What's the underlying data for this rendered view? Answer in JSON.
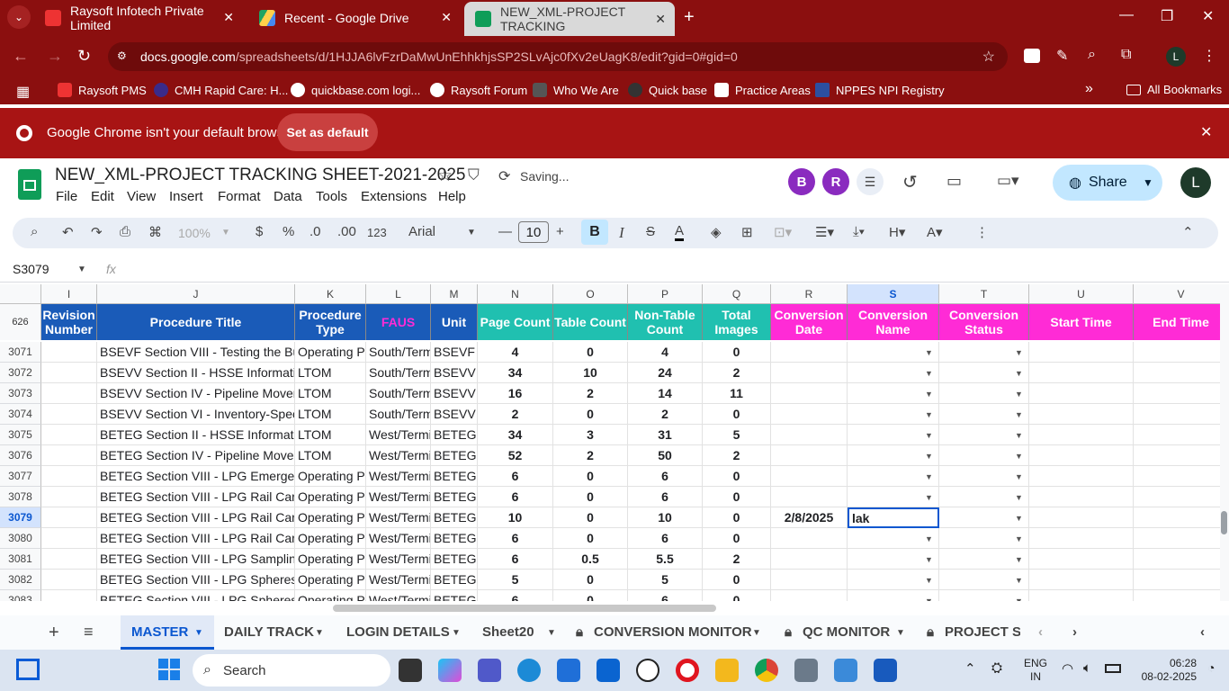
{
  "browser": {
    "tabs": [
      {
        "title": "Raysoft Infotech Private Limited",
        "active": false
      },
      {
        "title": "Recent - Google Drive",
        "active": false
      },
      {
        "title": "NEW_XML-PROJECT TRACKING",
        "active": true
      }
    ],
    "url_domain": "docs.google.com",
    "url_path": "/spreadsheets/d/1HJJA6lvFzrDaMwUnEhhkhjsSP2SLvAjc0fXv2eUagK8/edit?gid=0#gid=0",
    "bookmarks": [
      "Raysoft PMS",
      "CMH Rapid Care: H...",
      "quickbase.com logi...",
      "Raysoft Forum",
      "Who We Are",
      "Quick base",
      "Practice Areas",
      "NPPES NPI Registry"
    ],
    "all_bookmarks": "All Bookmarks",
    "profile_initial": "L",
    "infobar_text": "Google Chrome isn't your default browser",
    "set_default_label": "Set as default"
  },
  "doc": {
    "title": "NEW_XML-PROJECT TRACKING SHEET-2021-2025",
    "status": "Saving...",
    "menus": [
      "File",
      "Edit",
      "View",
      "Insert",
      "Format",
      "Data",
      "Tools",
      "Extensions",
      "Help"
    ],
    "avatars": [
      "B",
      "R"
    ],
    "share_label": "Share",
    "user_initial": "L"
  },
  "toolbar": {
    "zoom": "100%",
    "currency": "$",
    "percent": "%",
    "dec_dec": ".0",
    "inc_dec": ".00",
    "num_fmt": "123",
    "font": "Arial",
    "font_size": "10"
  },
  "formula_bar": {
    "name_box": "S3079",
    "fx": "fx"
  },
  "grid": {
    "freeze_label": "626",
    "col_letters": [
      "I",
      "J",
      "K",
      "L",
      "M",
      "N",
      "O",
      "P",
      "Q",
      "R",
      "S",
      "T",
      "U",
      "V"
    ],
    "headers": [
      "Revision Number",
      "Procedure Title",
      "Procedure Type",
      "FAUS",
      "Unit",
      "Page Count",
      "Table Count",
      "Non-Table Count",
      "Total Images",
      "Conversion Date",
      "Conversion Name",
      "Conversion Status",
      "Start Time",
      "End Time"
    ],
    "rows": [
      {
        "n": "3071",
        "title": "BSEVF Section VIII - Testing the Buta",
        "type": "Operating Pr",
        "faus": "South/Term",
        "unit": "BSEVF",
        "page": "4",
        "table": "0",
        "nontable": "4",
        "images": "0",
        "date": "",
        "name": ""
      },
      {
        "n": "3072",
        "title": "BSEVV Section II - HSSE Information",
        "type": "LTOM",
        "faus": "South/Term",
        "unit": "BSEVV",
        "page": "34",
        "table": "10",
        "nontable": "24",
        "images": "2",
        "date": "",
        "name": ""
      },
      {
        "n": "3073",
        "title": "BSEVV Section IV - Pipeline Moveme",
        "type": "LTOM",
        "faus": "South/Term",
        "unit": "BSEVV",
        "page": "16",
        "table": "2",
        "nontable": "14",
        "images": "11",
        "date": "",
        "name": ""
      },
      {
        "n": "3074",
        "title": "BSEVV Section VI - Inventory-Specific",
        "type": "LTOM",
        "faus": "South/Term",
        "unit": "BSEVV",
        "page": "2",
        "table": "0",
        "nontable": "2",
        "images": "0",
        "date": "",
        "name": ""
      },
      {
        "n": "3075",
        "title": "BETEG Section II - HSSE Information",
        "type": "LTOM",
        "faus": "West/Termi",
        "unit": "BETEG",
        "page": "34",
        "table": "3",
        "nontable": "31",
        "images": "5",
        "date": "",
        "name": ""
      },
      {
        "n": "3076",
        "title": "BETEG Section IV - Pipeline Moveme",
        "type": "LTOM",
        "faus": "West/Termi",
        "unit": "BETEG",
        "page": "52",
        "table": "2",
        "nontable": "50",
        "images": "2",
        "date": "",
        "name": ""
      },
      {
        "n": "3077",
        "title": "BETEG Section VIII - LPG Emergency",
        "type": "Operating Pr",
        "faus": "West/Termi",
        "unit": "BETEG",
        "page": "6",
        "table": "0",
        "nontable": "6",
        "images": "0",
        "date": "",
        "name": ""
      },
      {
        "n": "3078",
        "title": "BETEG Section VIII - LPG Rail Car Loa",
        "type": "Operating Pr",
        "faus": "West/Termi",
        "unit": "BETEG",
        "page": "6",
        "table": "0",
        "nontable": "6",
        "images": "0",
        "date": "",
        "name": ""
      },
      {
        "n": "3079",
        "title": "BETEG Section VIII - LPG Rail Car Loa",
        "type": "Operating Pr",
        "faus": "West/Termi",
        "unit": "BETEG",
        "page": "10",
        "table": "0",
        "nontable": "10",
        "images": "0",
        "date": "2/8/2025",
        "name": "lak"
      },
      {
        "n": "3080",
        "title": "BETEG Section VIII - LPG Rail Car Unl",
        "type": "Operating Pr",
        "faus": "West/Termi",
        "unit": "BETEG",
        "page": "6",
        "table": "0",
        "nontable": "6",
        "images": "0",
        "date": "",
        "name": ""
      },
      {
        "n": "3081",
        "title": "BETEG Section VIII - LPG Sampling Pr",
        "type": "Operating Pr",
        "faus": "West/Termi",
        "unit": "BETEG",
        "page": "6",
        "table": "0.5",
        "nontable": "5.5",
        "images": "2",
        "date": "",
        "name": ""
      },
      {
        "n": "3082",
        "title": "BETEG Section VIII - LPG Spheres Inc",
        "type": "Operating Pr",
        "faus": "West/Termi",
        "unit": "BETEG",
        "page": "5",
        "table": "0",
        "nontable": "5",
        "images": "0",
        "date": "",
        "name": ""
      },
      {
        "n": "3083",
        "title": "BETEG Section VIII - LPG Spheres No",
        "type": "Operating Pr",
        "faus": "West/Termi",
        "unit": "BETEG",
        "page": "6",
        "table": "0",
        "nontable": "6",
        "images": "0",
        "date": "",
        "name": ""
      }
    ]
  },
  "sheet_tabs": [
    "MASTER",
    "DAILY TRACK",
    "LOGIN DETAILS",
    "Sheet20",
    "CONVERSION MONITOR",
    "QC MONITOR",
    "PROJECT SU"
  ],
  "taskbar": {
    "search": "Search",
    "lang1": "ENG",
    "lang2": "IN",
    "time": "06:28",
    "date": "08-02-2025"
  },
  "colors": {
    "chrome": "#8b0f0f",
    "infobar": "#a81414",
    "hdr_blue": "#1a5bb8",
    "hdr_green": "#20c0b0",
    "hdr_pink": "#ff2bd6",
    "hdr_yellow": "#fff200"
  }
}
